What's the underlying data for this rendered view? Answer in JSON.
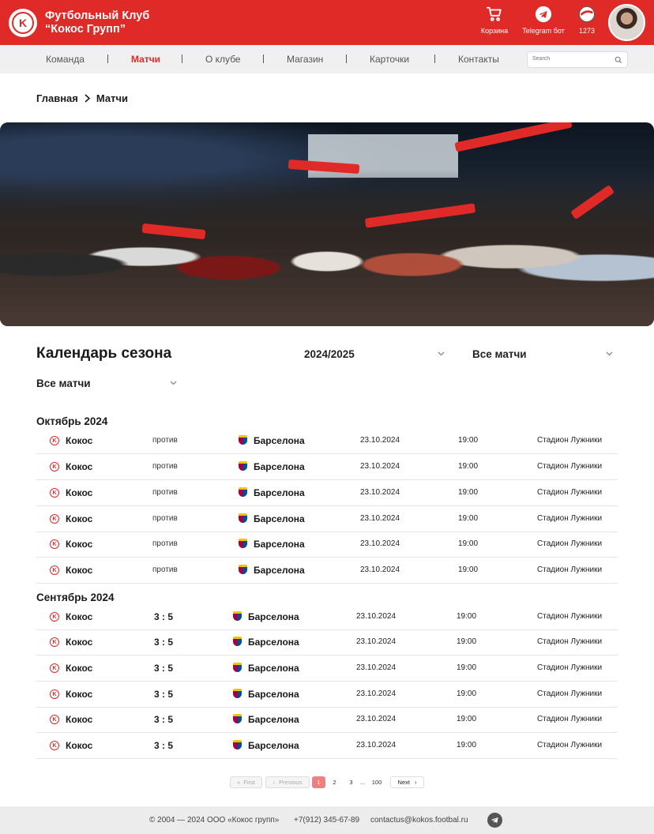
{
  "header": {
    "club_line1": "Футбольный Клуб",
    "club_line2": "“Кокос Групп”",
    "logo_letter": "K",
    "cart_label": "Корзина",
    "telegram_label": "Telegram бот",
    "coins": "1273"
  },
  "nav": {
    "items": [
      "Команда",
      "Матчи",
      "О клубе",
      "Магазин",
      "Карточки",
      "Контакты"
    ],
    "active": "Матчи",
    "search_placeholder": "Search"
  },
  "breadcrumb": {
    "home": "Главная",
    "current": "Матчи"
  },
  "calendar": {
    "title": "Календарь сезона",
    "season": "2024/2025",
    "filter1": "Все матчи",
    "filter2": "Все матчи"
  },
  "months": [
    {
      "name": "Октябрь 2024",
      "matches": [
        {
          "home": "Кокос",
          "middle": "против",
          "away": "Барселона",
          "date": "23.10.2024",
          "time": "19:00",
          "venue": "Стадион Лужники"
        },
        {
          "home": "Кокос",
          "middle": "против",
          "away": "Барселона",
          "date": "23.10.2024",
          "time": "19:00",
          "venue": "Стадион Лужники"
        },
        {
          "home": "Кокос",
          "middle": "против",
          "away": "Барселона",
          "date": "23.10.2024",
          "time": "19:00",
          "venue": "Стадион Лужники"
        },
        {
          "home": "Кокос",
          "middle": "против",
          "away": "Барселона",
          "date": "23.10.2024",
          "time": "19:00",
          "venue": "Стадион Лужники"
        },
        {
          "home": "Кокос",
          "middle": "против",
          "away": "Барселона",
          "date": "23.10.2024",
          "time": "19:00",
          "venue": "Стадион Лужники"
        },
        {
          "home": "Кокос",
          "middle": "против",
          "away": "Барселона",
          "date": "23.10.2024",
          "time": "19:00",
          "venue": "Стадион Лужники"
        }
      ]
    },
    {
      "name": "Сентябрь 2024",
      "matches": [
        {
          "home": "Кокос",
          "middle": "3 : 5",
          "away": "Барселона",
          "date": "23.10.2024",
          "time": "19:00",
          "venue": "Стадион Лужники"
        },
        {
          "home": "Кокос",
          "middle": "3 : 5",
          "away": "Барселона",
          "date": "23.10.2024",
          "time": "19:00",
          "venue": "Стадион Лужники"
        },
        {
          "home": "Кокос",
          "middle": "3 : 5",
          "away": "Барселона",
          "date": "23.10.2024",
          "time": "19:00",
          "venue": "Стадион Лужники"
        },
        {
          "home": "Кокос",
          "middle": "3 : 5",
          "away": "Барселона",
          "date": "23.10.2024",
          "time": "19:00",
          "venue": "Стадион Лужники"
        },
        {
          "home": "Кокос",
          "middle": "3 : 5",
          "away": "Барселона",
          "date": "23.10.2024",
          "time": "19:00",
          "venue": "Стадион Лужники"
        },
        {
          "home": "Кокос",
          "middle": "3 : 5",
          "away": "Барселона",
          "date": "23.10.2024",
          "time": "19:00",
          "venue": "Стадион Лужники"
        }
      ]
    }
  ],
  "pagination": {
    "first": "First",
    "previous": "Previous",
    "pages": [
      "1",
      "2",
      "3",
      "...",
      "100"
    ],
    "current": "1",
    "next": "Next"
  },
  "footer": {
    "copyright": "© 2004 — 2024 ООО «Кокос групп»",
    "phone": "+7(912) 345-67-89",
    "email": "contactus@kokos.footbal.ru"
  },
  "colors": {
    "brand_red": "#e02a27",
    "nav_bg": "#f0f0f0",
    "footer_bg": "#ececec",
    "page_active": "#f08080"
  }
}
